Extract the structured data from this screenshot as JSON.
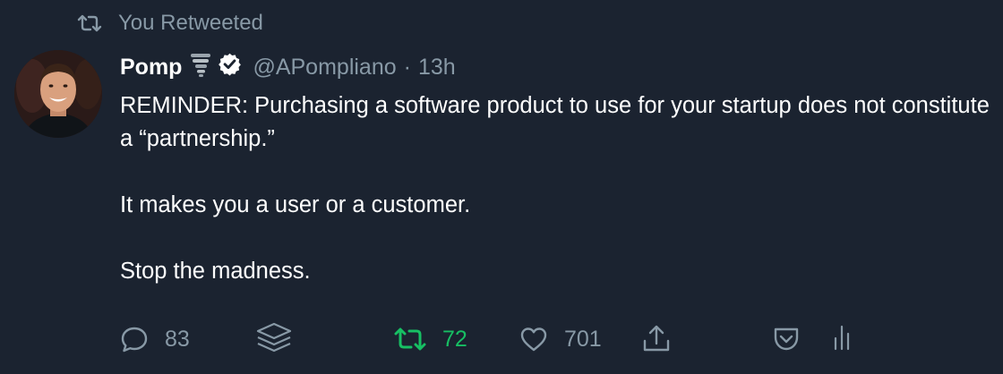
{
  "retweet_context": {
    "label": "You Retweeted"
  },
  "tweet": {
    "author": {
      "name": "Pomp",
      "handle": "@APompliano",
      "name_emoji": "tornado-icon",
      "verified": true
    },
    "separator": "·",
    "time": "13h",
    "paragraphs": [
      "REMINDER: Purchasing a software product to use for your startup does not constitute a “partnership.”",
      "It makes you a user or a customer.",
      "Stop the madness."
    ]
  },
  "actions": {
    "reply_count": "83",
    "retweet_count": "72",
    "like_count": "701",
    "retweeted": true
  },
  "colors": {
    "background": "#1b2330",
    "muted": "#8899a6",
    "retweet_active": "#17bf63",
    "verified_badge": "#ffffff",
    "text": "#ffffff"
  }
}
